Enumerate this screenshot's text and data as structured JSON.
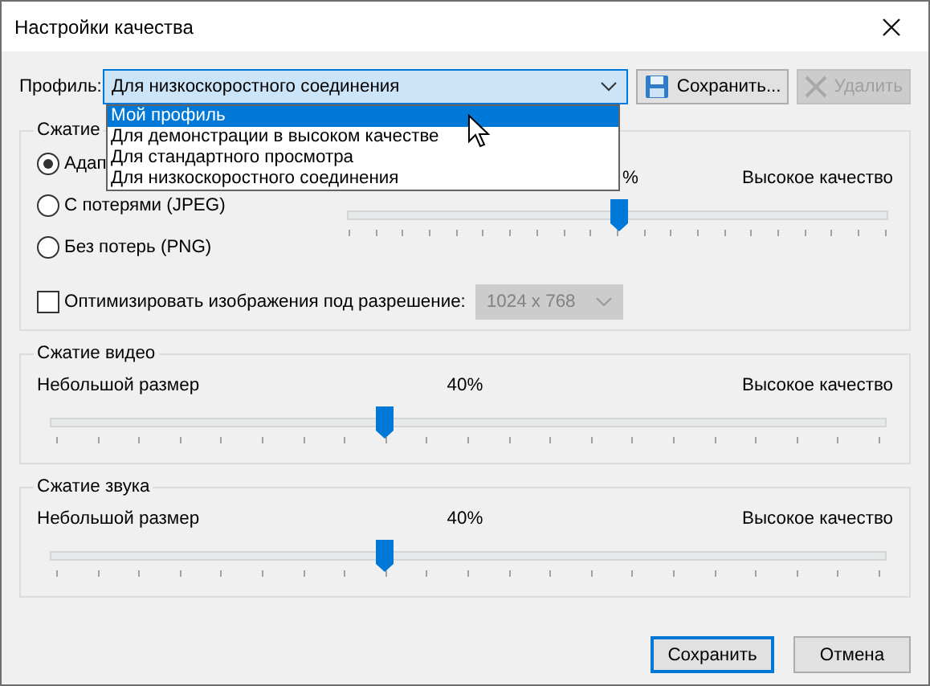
{
  "window": {
    "title": "Настройки качества"
  },
  "profile": {
    "label": "Профиль:",
    "value": "Для низкоскоростного соединения",
    "options": [
      {
        "label": "Мой профиль",
        "highlighted": true
      },
      {
        "label": "Для демонстрации в высоком качестве",
        "highlighted": false
      },
      {
        "label": "Для стандартного просмотра",
        "highlighted": false
      },
      {
        "label": "Для низкоскоростного соединения",
        "highlighted": false
      }
    ]
  },
  "toolbar_buttons": [
    {
      "label": "Сохранить...",
      "kind": "save",
      "disabled": false
    },
    {
      "label": "Удалить",
      "kind": "delete",
      "disabled": true
    }
  ],
  "image_compression": {
    "title": "Сжатие",
    "radios": [
      {
        "label": "Адап",
        "selected": true
      },
      {
        "label": "С потерями (JPEG)",
        "selected": false
      },
      {
        "label": "Без потерь (PNG)",
        "selected": false
      }
    ],
    "slider": {
      "reading": "%",
      "right_label": "Высокое качество",
      "level": 0.5
    },
    "optimize": {
      "label": "Оптимизировать изображения под разрешение:",
      "checked": false
    },
    "resolution": {
      "value": "1024 x 768",
      "disabled": true
    }
  },
  "video_compression": {
    "title": "Сжатие видео",
    "left_label": "Небольшой размер",
    "reading": "40%",
    "right_label": "Высокое качество",
    "level": 0.4
  },
  "audio_compression": {
    "title": "Сжатие звука",
    "left_label": "Небольшой размер",
    "reading": "40%",
    "right_label": "Высокое качество",
    "level": 0.4
  },
  "buttons": [
    {
      "label": "Сохранить",
      "default": true
    },
    {
      "label": "Отмена",
      "default": false
    }
  ]
}
